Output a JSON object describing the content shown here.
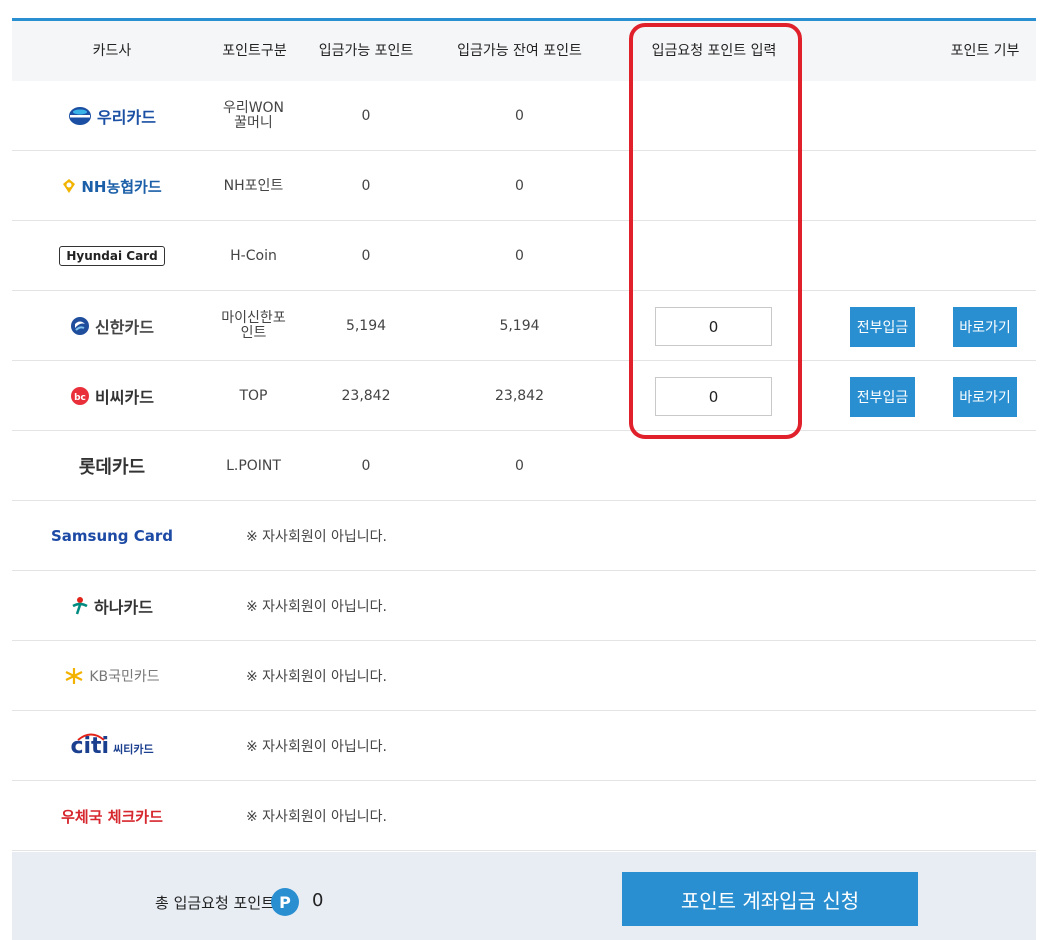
{
  "header": {
    "col_card": "카드사",
    "col_type": "포인트구분",
    "col_available": "입금가능 포인트",
    "col_remaining": "입금가능 잔여 포인트",
    "col_request": "입금요청 포인트 입력",
    "col_donate": "포인트 기부"
  },
  "rows": [
    {
      "logo": "우리카드",
      "type": "우리WON 꿀머니",
      "available": "0",
      "remaining": "0"
    },
    {
      "logo": "NH농협카드",
      "type": "NH포인트",
      "available": "0",
      "remaining": "0"
    },
    {
      "logo": "Hyundai Card",
      "type": "H-Coin",
      "available": "0",
      "remaining": "0"
    },
    {
      "logo": "신한카드",
      "type": "마이신한포 인트",
      "available": "5,194",
      "remaining": "5,194",
      "request": "0",
      "deposit_all": "전부입금",
      "go": "바로가기"
    },
    {
      "logo": "비씨카드",
      "type": "TOP",
      "available": "23,842",
      "remaining": "23,842",
      "request": "0",
      "deposit_all": "전부입금",
      "go": "바로가기"
    },
    {
      "logo": "롯데카드",
      "type": "L.POINT",
      "available": "0",
      "remaining": "0"
    },
    {
      "logo": "Samsung Card",
      "note": "※ 자사회원이 아닙니다."
    },
    {
      "logo": "하나카드",
      "note": "※ 자사회원이 아닙니다."
    },
    {
      "logo": "KB국민카드",
      "note": "※ 자사회원이 아닙니다."
    },
    {
      "logo_a": "citi",
      "logo_b": "씨티카드",
      "note": "※ 자사회원이 아닙니다."
    },
    {
      "logo": "우체국 체크카드",
      "note": "※ 자사회원이 아닙니다."
    }
  ],
  "footer": {
    "total_label": "총 입금요청 포인트",
    "badge": "P",
    "total": "0",
    "submit": "포인트 계좌입금 신청"
  },
  "colors": {
    "accent": "#2a8fd1",
    "highlight": "#e0202a",
    "woori": "#1a4fa3",
    "nh": "#1a5fa8",
    "shinhan": "#1f4e9c",
    "bc": "#e9303a",
    "samsung": "#1d4aa5",
    "hana": "#008b80",
    "kb": "#f3b200",
    "citi": "#1b3f8f",
    "post": "#d6262e"
  }
}
